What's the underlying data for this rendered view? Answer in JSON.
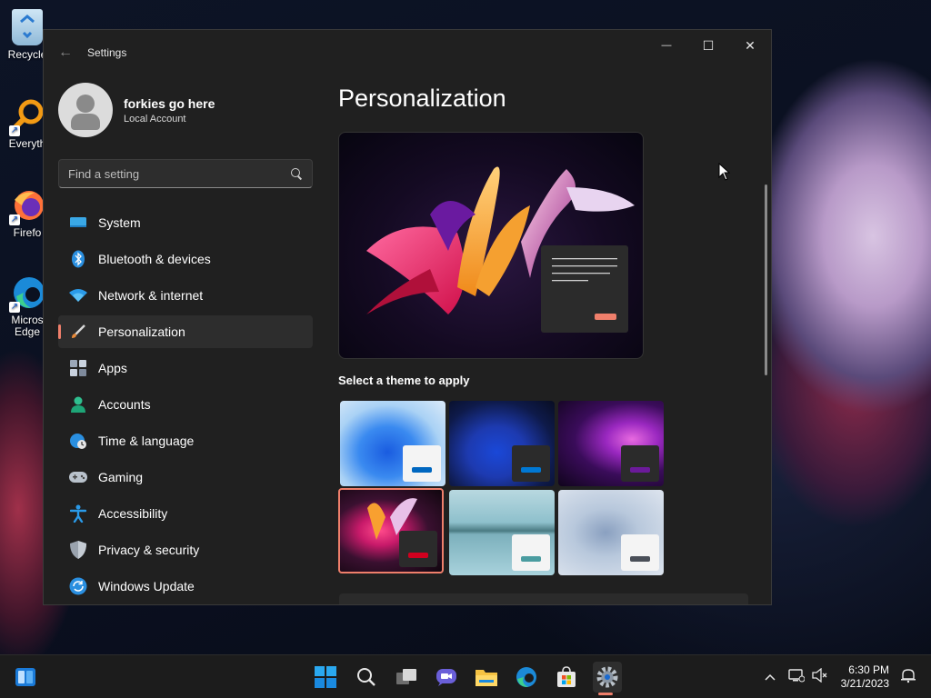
{
  "desktop": {
    "icons": [
      {
        "label": "Recycle",
        "icon": "recycle-bin-icon"
      },
      {
        "label": "Everyth",
        "icon": "everything-search-icon"
      },
      {
        "label": "Firefo",
        "icon": "firefox-icon"
      },
      {
        "label": "Micros Edge",
        "icon": "edge-icon"
      }
    ]
  },
  "window": {
    "title": "Settings",
    "back": "←",
    "controls": {
      "minimize": "—",
      "maximize": "☐",
      "close": "✕"
    }
  },
  "profile": {
    "name": "forkies go here",
    "account_type": "Local Account"
  },
  "search": {
    "placeholder": "Find a setting"
  },
  "nav": [
    {
      "label": "System",
      "icon": "system-display-icon"
    },
    {
      "label": "Bluetooth & devices",
      "icon": "bluetooth-icon"
    },
    {
      "label": "Network & internet",
      "icon": "wifi-icon"
    },
    {
      "label": "Personalization",
      "icon": "paintbrush-icon",
      "active": true
    },
    {
      "label": "Apps",
      "icon": "apps-icon"
    },
    {
      "label": "Accounts",
      "icon": "person-icon"
    },
    {
      "label": "Time & language",
      "icon": "globe-clock-icon"
    },
    {
      "label": "Gaming",
      "icon": "gamepad-icon"
    },
    {
      "label": "Accessibility",
      "icon": "accessibility-icon"
    },
    {
      "label": "Privacy & security",
      "icon": "shield-icon"
    },
    {
      "label": "Windows Update",
      "icon": "update-icon"
    }
  ],
  "main": {
    "title": "Personalization",
    "theme_section_label": "Select a theme to apply",
    "themes": [
      {
        "name": "windows-light",
        "accent": "#0067c0",
        "selected": false
      },
      {
        "name": "windows-dark",
        "accent": "#0078d4",
        "selected": false
      },
      {
        "name": "glow",
        "accent": "#6b1a9a",
        "selected": false
      },
      {
        "name": "captured-motion",
        "accent": "#d1001f",
        "selected": true
      },
      {
        "name": "sunrise",
        "accent": "#4a9ca0",
        "selected": false
      },
      {
        "name": "flow",
        "accent": "#4a4f58",
        "selected": false
      }
    ]
  },
  "taskbar": {
    "clock_time": "6:30 PM",
    "clock_date": "3/21/2023",
    "apps": [
      "start-icon",
      "search-icon",
      "task-view-icon",
      "chat-icon",
      "file-explorer-icon",
      "edge-icon",
      "store-icon",
      "settings-icon"
    ],
    "running_app": "settings-icon"
  },
  "colors": {
    "accent": "#ef7f6b",
    "window_bg": "#202020"
  }
}
